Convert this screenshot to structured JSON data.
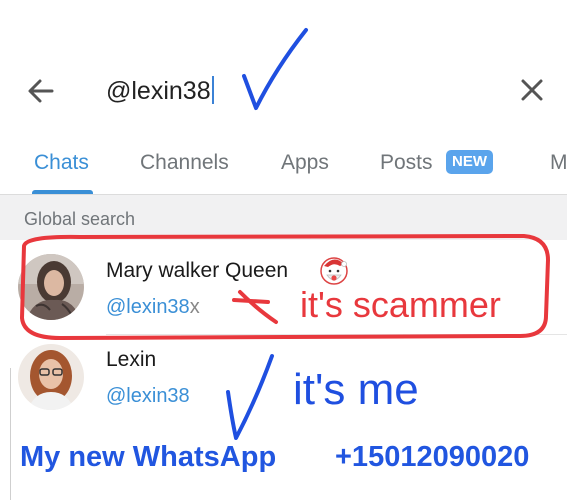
{
  "search": {
    "query": "@lexin38"
  },
  "tabs": {
    "items": [
      {
        "label": "Chats"
      },
      {
        "label": "Channels"
      },
      {
        "label": "Apps"
      },
      {
        "label": "Posts"
      },
      {
        "label": "M"
      }
    ],
    "posts_badge": "NEW",
    "active": "Chats"
  },
  "section": {
    "title": "Global search"
  },
  "results": [
    {
      "name": "Mary walker Queen",
      "emoji_icon": "santa-icon",
      "handle": "@lexin38",
      "handle_suffix": "x"
    },
    {
      "name": "Lexin",
      "handle": "@lexin38"
    }
  ],
  "annotations": {
    "scam": "it's scammer",
    "me": "it's me",
    "footer_label": "My new WhatsApp",
    "footer_phone": "+15012090020"
  },
  "colors": {
    "accent": "#3a8fd6",
    "annotation_red": "#e8383d",
    "annotation_blue": "#1f4fe0"
  }
}
